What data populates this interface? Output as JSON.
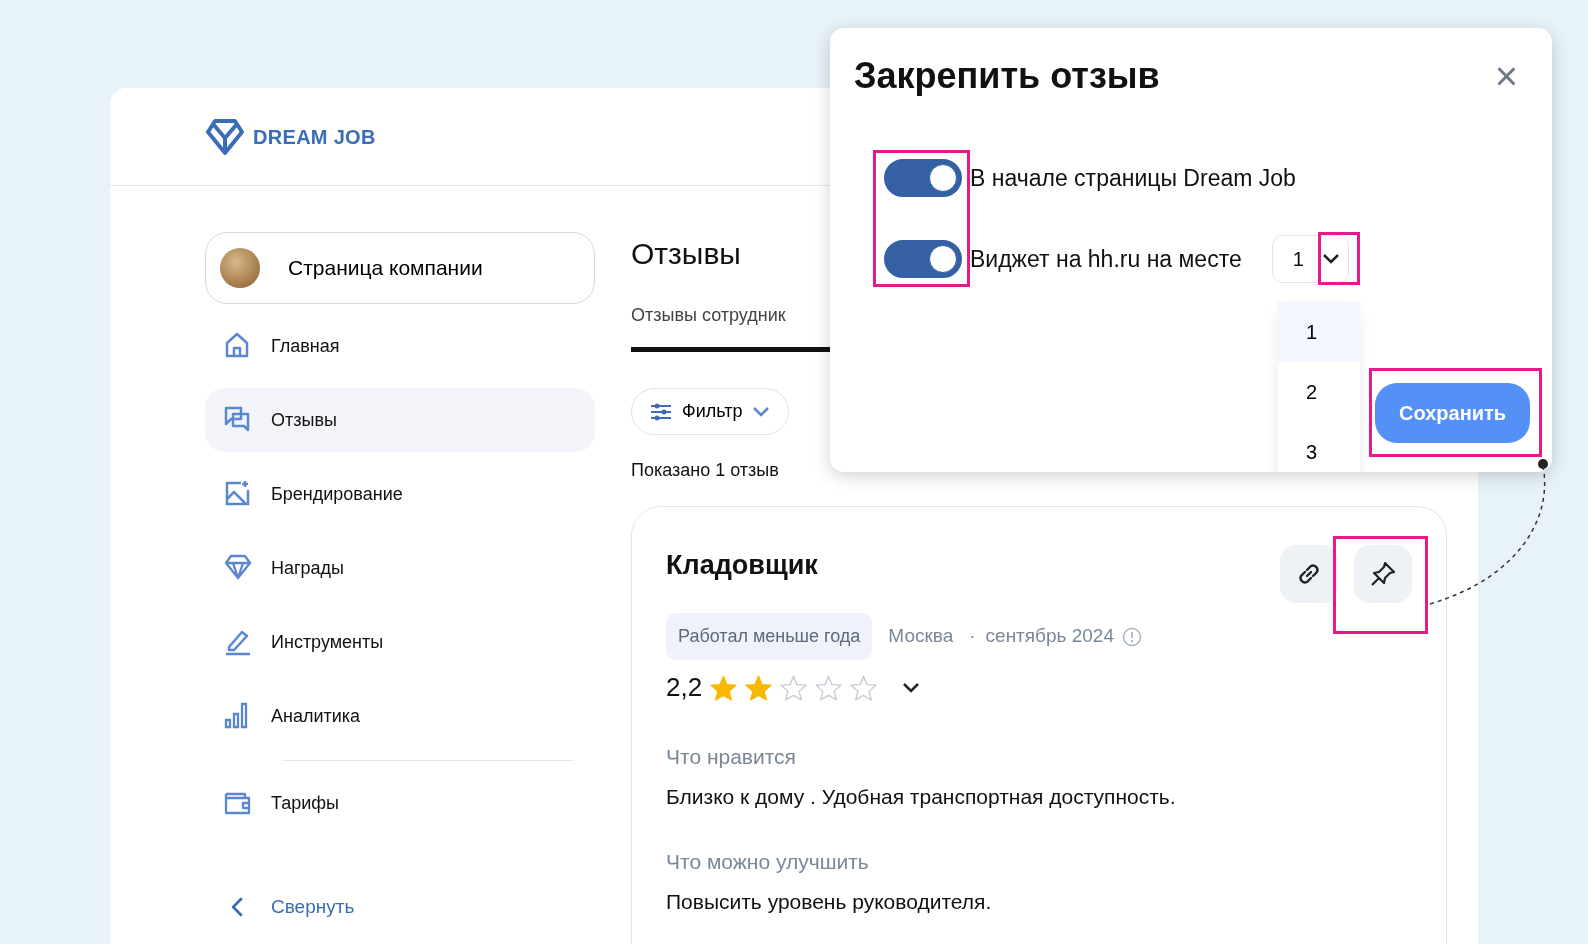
{
  "logo": {
    "text": "DREAM JOB"
  },
  "sidebar": {
    "company": {
      "label": "Страница компании"
    },
    "items": [
      {
        "label": "Главная",
        "kind": "home",
        "selected": false
      },
      {
        "label": "Отзывы",
        "kind": "chat",
        "selected": true
      },
      {
        "label": "Брендирование",
        "kind": "image",
        "selected": false
      },
      {
        "label": "Награды",
        "kind": "diamond",
        "selected": false
      },
      {
        "label": "Инструменты",
        "kind": "pencil",
        "selected": false
      },
      {
        "label": "Аналитика",
        "kind": "bars",
        "selected": false
      }
    ],
    "extra_items": [
      {
        "label": "Тарифы",
        "kind": "wallet",
        "selected": false
      }
    ],
    "collapse": {
      "label": "Свернуть"
    }
  },
  "content": {
    "title": "Отзывы",
    "tabs": [
      {
        "label": "Отзывы сотрудник",
        "selected": true
      }
    ],
    "filter": {
      "label": "Фильтр"
    },
    "shown_count": "Показано 1 отзыв",
    "review": {
      "title": "Кладовщик",
      "tag": "Работал меньше года",
      "city": "Москва",
      "separator": "·",
      "date": "сентябрь 2024",
      "rating": "2,2",
      "stars": 2,
      "sections": [
        {
          "heading": "Что нравится",
          "text": "Близко к дому . Удобная транспортная доступность."
        },
        {
          "heading": "Что можно улучшить",
          "text": "Повысить уровень руководителя."
        }
      ]
    }
  },
  "modal": {
    "title": "Закрепить отзыв",
    "close": "×",
    "options": [
      {
        "label": "В начале страницы Dream Job",
        "on": true
      },
      {
        "label": "Виджет на hh.ru на месте",
        "on": true
      }
    ],
    "position_value": "1",
    "dropdown": [
      {
        "label": "1",
        "selected": true
      },
      {
        "label": "2",
        "selected": false
      },
      {
        "label": "3",
        "selected": false
      }
    ],
    "save": "Сохранить"
  }
}
